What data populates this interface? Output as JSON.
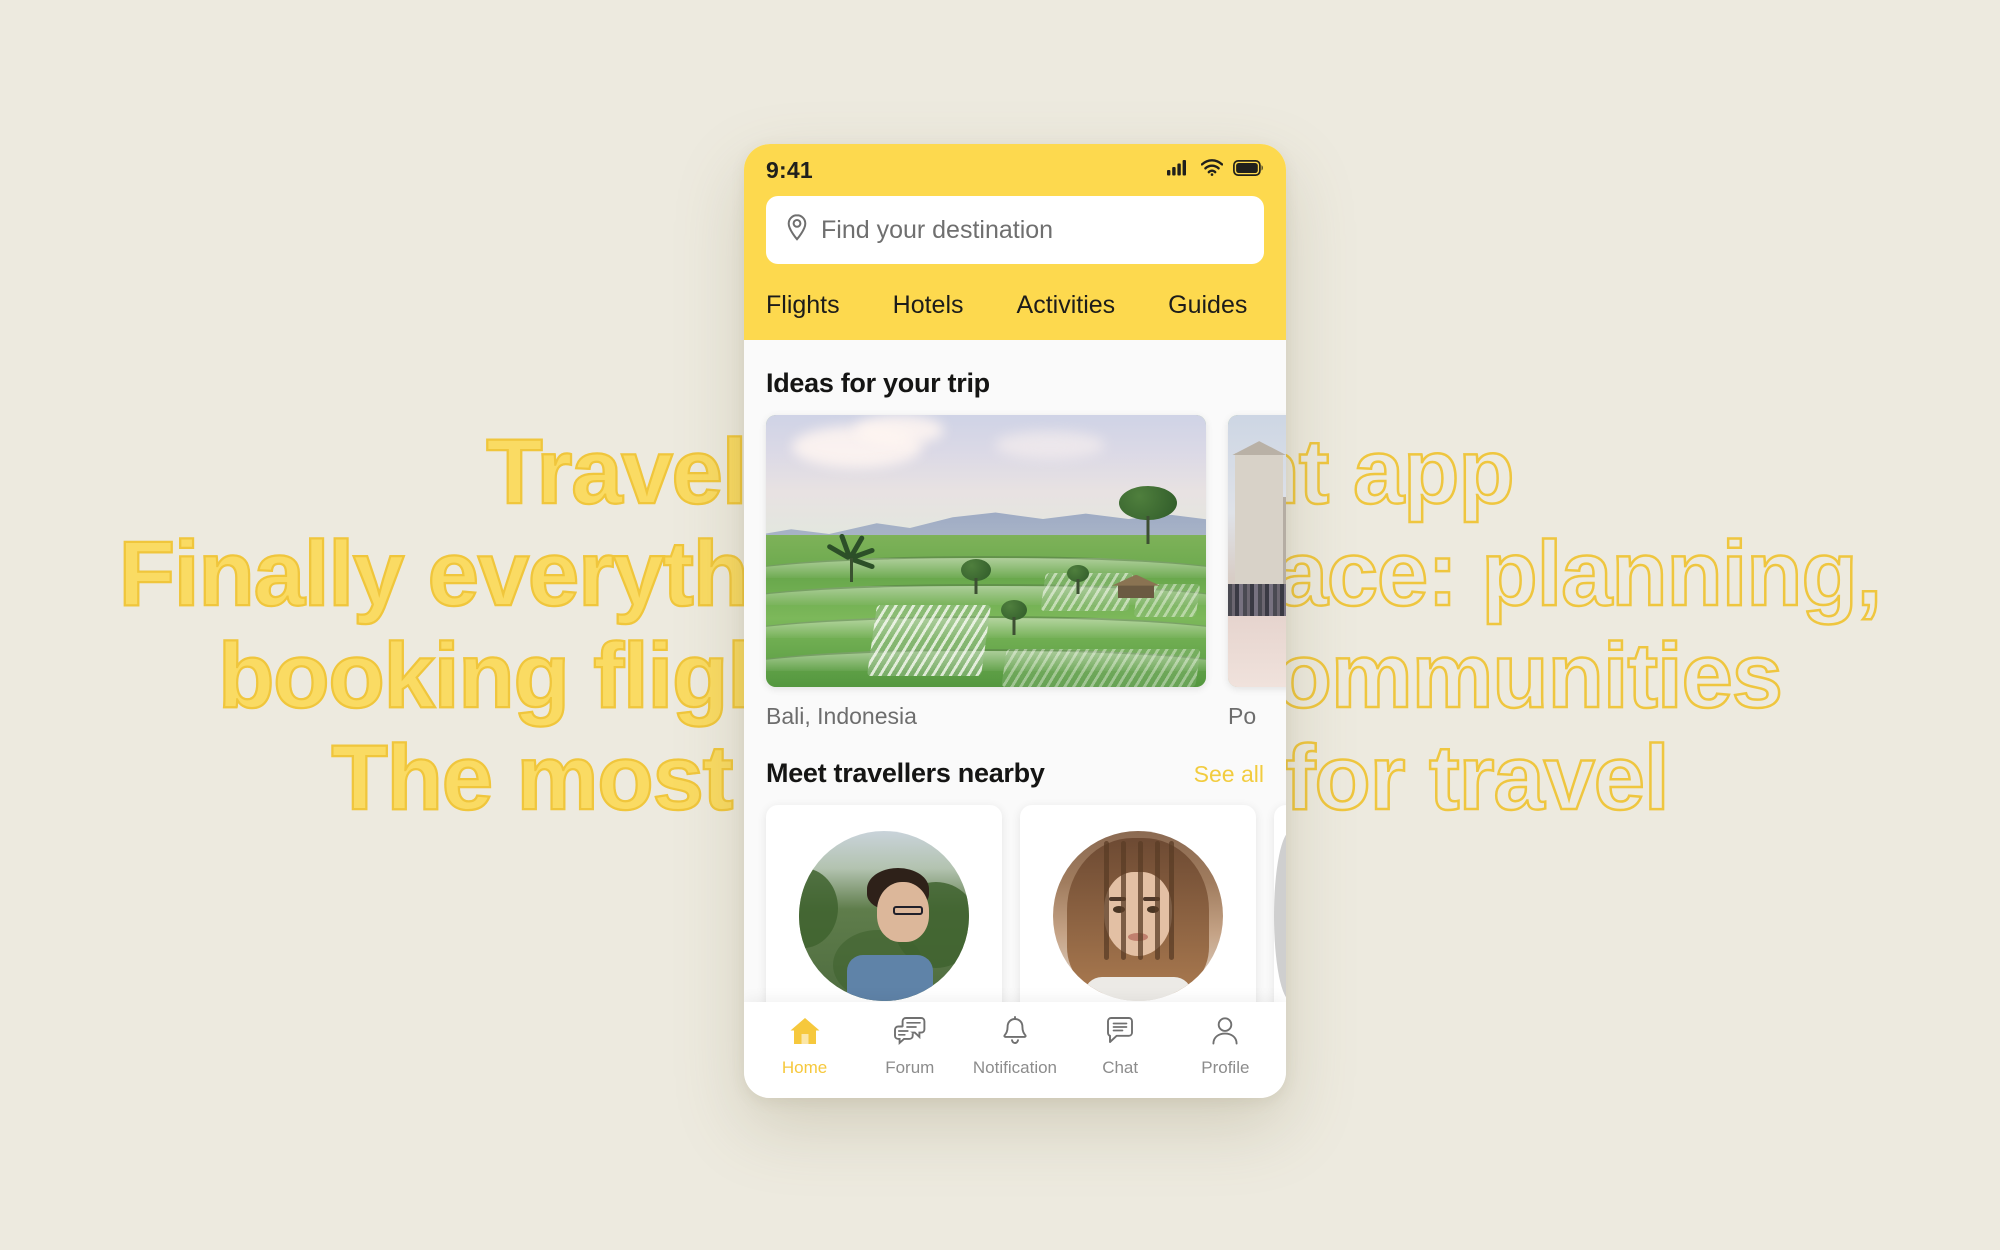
{
  "background": {
    "canvas_color": "#edeadf",
    "headline_color_fill": "#f9d749",
    "headline_color_outline": "#efc63f",
    "lines": [
      "Travel management app",
      "Finally everything in one place: planning,",
      "booking flights, hotels, communities",
      "The most reliable tool for travel"
    ]
  },
  "phone": {
    "accent_color": "#fdd94e",
    "status_bar": {
      "time": "9:41",
      "icons": [
        "signal-icon",
        "wifi-icon",
        "battery-icon"
      ]
    },
    "search": {
      "placeholder": "Find your destination",
      "icon": "map-pin-icon",
      "value": ""
    },
    "nav_tabs": [
      {
        "label": "Flights"
      },
      {
        "label": "Hotels"
      },
      {
        "label": "Activities"
      },
      {
        "label": "Guides"
      }
    ],
    "ideas_section": {
      "title": "Ideas for your trip",
      "cards": [
        {
          "caption": "Bali, Indonesia"
        },
        {
          "caption": "Po"
        }
      ]
    },
    "travellers_section": {
      "title": "Meet travellers nearby",
      "see_all": "See all",
      "cards": [
        {
          "avatar": "traveller-avatar-1"
        },
        {
          "avatar": "traveller-avatar-2"
        },
        {
          "avatar": "traveller-avatar-3"
        }
      ]
    },
    "bottom_nav": {
      "active_color": "#f6c83c",
      "inactive_color": "#8c8c8c",
      "items": [
        {
          "label": "Home",
          "icon": "home-icon",
          "active": true
        },
        {
          "label": "Forum",
          "icon": "forum-icon",
          "active": false
        },
        {
          "label": "Notification",
          "icon": "bell-icon",
          "active": false
        },
        {
          "label": "Chat",
          "icon": "chat-icon",
          "active": false
        },
        {
          "label": "Profile",
          "icon": "profile-icon",
          "active": false
        }
      ]
    }
  }
}
